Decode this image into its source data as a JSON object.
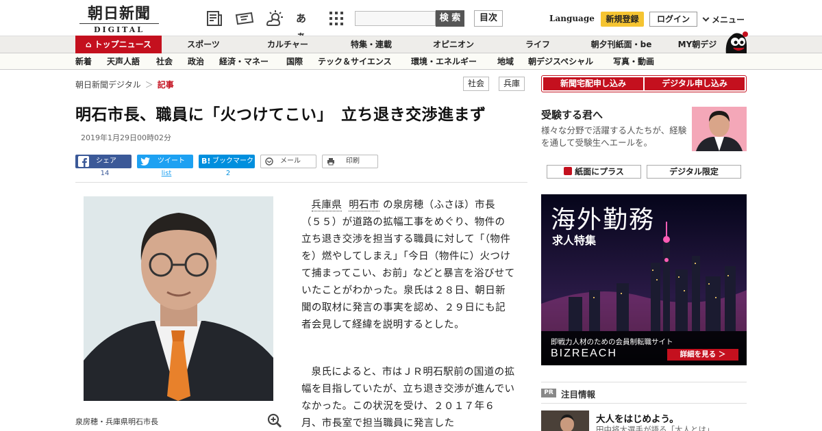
{
  "header": {
    "logo_text": "朝日新聞",
    "logo_sub": "DIGITAL",
    "search_button": "検 索",
    "toc_button": "目次",
    "language": "Language",
    "register": "新規登録",
    "login": "ログイン",
    "menu": "メニュー",
    "icons": [
      "newspaper-icon",
      "ticket-icon",
      "weather-icon",
      "text-size-icon",
      "grid-icon"
    ],
    "text_size_glyph": "あぁ"
  },
  "nav_primary": {
    "top_news": "トップニュース",
    "items": [
      "スポーツ",
      "カルチャー",
      "特集・連載",
      "オピニオン",
      "ライフ",
      "朝夕刊紙面・be",
      "MY朝デジ"
    ]
  },
  "nav_secondary": {
    "items": [
      "新着",
      "天声人語",
      "社会",
      "政治",
      "経済・マネー",
      "国際",
      "テック＆サイエンス",
      "環境・エネルギー",
      "地域",
      "朝デジスペシャル",
      "写真・動画"
    ]
  },
  "breadcrumb": {
    "home": "朝日新聞デジタル",
    "separator": "＞",
    "current": "記事"
  },
  "tags": [
    "社会",
    "兵庫"
  ],
  "article": {
    "title": "明石市長、職員に「火つけてこい」　立ち退き交渉進まず",
    "date": "2019年1月29日00時02分",
    "photo_caption": "泉房穂・兵庫県明石市長",
    "para1_link1": "兵庫県",
    "para1_link2": "明石市",
    "para1_text": "の泉房穂（ふさほ）市長（５５）が道路の拡幅工事をめぐり、物件の立ち退き交渉を担当する職員に対して「（物件を）燃やしてしまえ」「今日（物件に）火つけて捕まってこい、お前」などと暴言を浴びせていたことがわかった。泉氏は２８日、朝日新聞の取材に発言の事実を認め、２９日にも記者会見して経緯を説明するとした。",
    "para2_text": "泉氏によると、市はＪＲ明石駅前の国道の拡幅を目指していたが、立ち退き交渉が進んでいなかった。この状況を受け、２０１７年６月、市長室で担当職員に発言した"
  },
  "share": {
    "facebook_label": "シェア",
    "facebook_count": "14",
    "twitter_label": "ツイート",
    "twitter_count": "list",
    "hatena_label": "ブックマーク",
    "hatena_glyph": "B!",
    "hatena_count": "2",
    "mail_label": "メール",
    "print_label": "印刷"
  },
  "sidebar": {
    "subscribe_paper": "新聞宅配申し込み",
    "subscribe_digital": "デジタル申し込み",
    "exam_title": "受験する君へ",
    "exam_desc": "様々な分野で活躍する人たちが、経験を通して受験生へエールを。",
    "paper_plus": "紙面にプラス",
    "digital_only": "デジタル限定",
    "ad_title": "海外勤務",
    "ad_subtitle": "求人特集",
    "ad_tagline": "即戦力人材のための会員制転職サイト",
    "ad_brand": "BIZREACH",
    "ad_cta": "詳細を見る ＞",
    "pr_badge": "PR",
    "pr_title": "注目情報",
    "pr_item_title": "大人をはじめよう。",
    "pr_item_sub": "田中将大選手が語る「大人とは」"
  },
  "colors": {
    "brand_red": "#c4101e",
    "facebook": "#3b5998",
    "twitter": "#1da1f2",
    "hatena": "#008fde",
    "register_yellow": "#f5c431"
  }
}
